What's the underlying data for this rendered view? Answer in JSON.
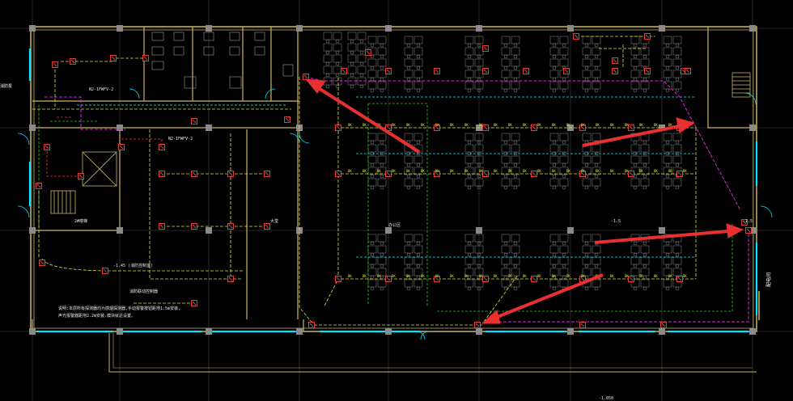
{
  "drawing": {
    "background": "#000000",
    "colors": {
      "grid": "#2a2a2a",
      "wall": "#c8b46a",
      "column": "#9a9a9a",
      "window": "#00e5ff",
      "fire_alarm_loop": "#e0e040",
      "green_circuit": "#22cc22",
      "magenta_circuit": "#dd22dd",
      "red_circuit": "#ff3030",
      "cyan_circuit": "#00ffff",
      "device": "#ff4040",
      "furniture": "#b0b0b0",
      "arrow": "#e83030"
    },
    "labels": [
      {
        "id": "lbl-room-1",
        "text": "N2-1FWFV-2"
      },
      {
        "id": "lbl-room-2",
        "text": "N2-1FWFV-2"
      },
      {
        "id": "lbl-stair",
        "text": "2#楼梯"
      },
      {
        "id": "lbl-hall",
        "text": "大堂"
      },
      {
        "id": "lbl-office",
        "text": "办公区"
      },
      {
        "id": "lbl-corridor",
        "text": "-1.45 (消防控制室)"
      },
      {
        "id": "lbl-note-1",
        "text": "消防联动控制器"
      },
      {
        "id": "lbl-note-2",
        "text": "说明:本层所有探测器均为感烟探测器,手动报警按钮距地1.5m安装,"
      },
      {
        "id": "lbl-note-3",
        "text": "声光报警器距地2.2m安装,模块就近设置。"
      },
      {
        "id": "lbl-level-1",
        "text": "-1.5"
      },
      {
        "id": "lbl-level-2",
        "text": "-1.5"
      },
      {
        "id": "lbl-side",
        "text": "配电间"
      },
      {
        "id": "lbl-bottom",
        "text": "-1.050"
      },
      {
        "id": "lbl-left",
        "text": "消防泵"
      }
    ],
    "annotation_arrows": [
      {
        "name": "arrow-top-center"
      },
      {
        "name": "arrow-top-right"
      },
      {
        "name": "arrow-middle-right"
      },
      {
        "name": "arrow-bottom-center"
      }
    ]
  }
}
